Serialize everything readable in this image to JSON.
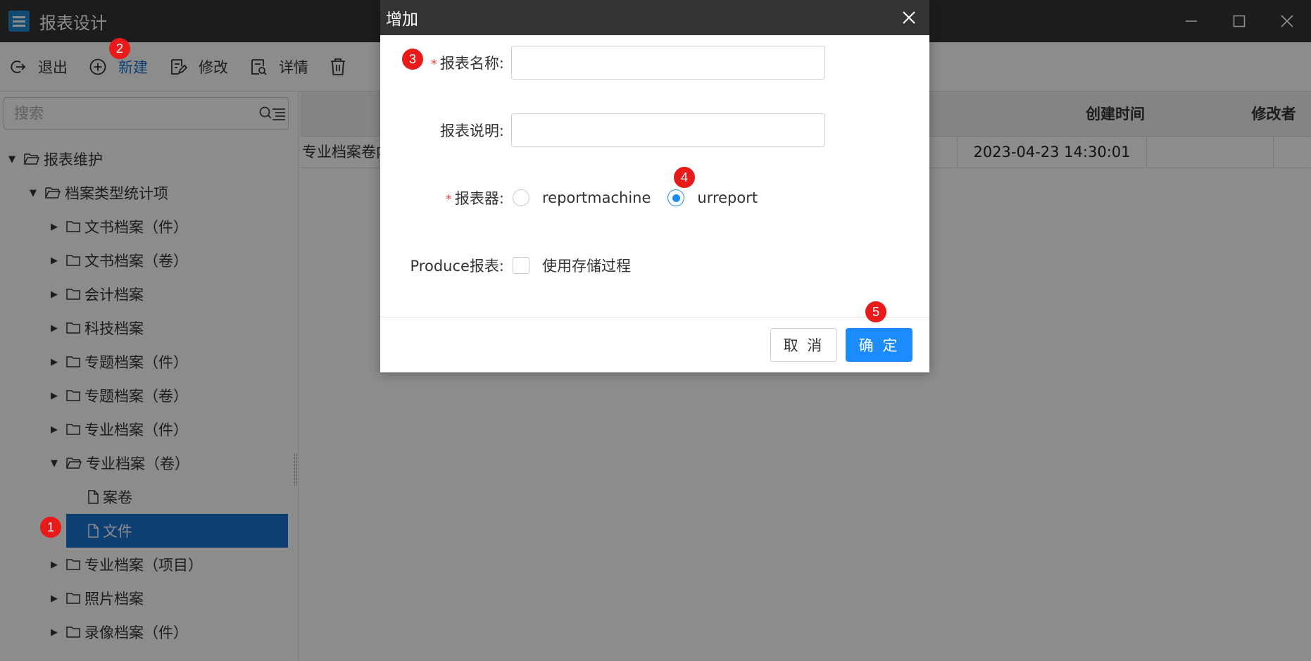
{
  "window": {
    "title": "报表设计"
  },
  "toolbar": {
    "items": [
      {
        "label": "退出"
      },
      {
        "label": "新建"
      },
      {
        "label": "修改"
      },
      {
        "label": "详情"
      }
    ]
  },
  "search": {
    "placeholder": "搜索"
  },
  "tree": {
    "nodes": [
      {
        "label": "报表维护"
      },
      {
        "label": "档案类型统计项"
      },
      {
        "label": "文书档案（件）"
      },
      {
        "label": "文书档案（卷）"
      },
      {
        "label": "会计档案"
      },
      {
        "label": "科技档案"
      },
      {
        "label": "专题档案（件）"
      },
      {
        "label": "专题档案（卷）"
      },
      {
        "label": "专业档案（件）"
      },
      {
        "label": "专业档案（卷）"
      },
      {
        "label": "案卷"
      },
      {
        "label": "文件"
      },
      {
        "label": "专业档案（项目）"
      },
      {
        "label": "照片档案"
      },
      {
        "label": "录像档案（件）"
      }
    ]
  },
  "table": {
    "headers": {
      "created": "创建时间",
      "modifier": "修改者"
    },
    "rows": [
      {
        "name": "专业档案卷内",
        "created": "2023-04-23 14:30:01",
        "modifier": ""
      }
    ]
  },
  "dialog": {
    "title": "增加",
    "fields": {
      "name_label": "报表名称",
      "name_value": "",
      "desc_label": "报表说明",
      "desc_value": "",
      "engine_label": "报表器",
      "engine_options": [
        "reportmachine",
        "urreport"
      ],
      "engine_selected": "urreport",
      "produce_label": "Produce报表",
      "produce_option": "使用存储过程",
      "produce_checked": false
    },
    "required_mark": "*",
    "colon": ":",
    "cancel": "取 消",
    "ok": "确 定"
  },
  "markers": [
    "1",
    "2",
    "3",
    "4",
    "5"
  ],
  "colors": {
    "accent": "#1a8cff",
    "selected": "#1a73d1",
    "marker": "#e81a1a",
    "titlebar": "#333333"
  }
}
